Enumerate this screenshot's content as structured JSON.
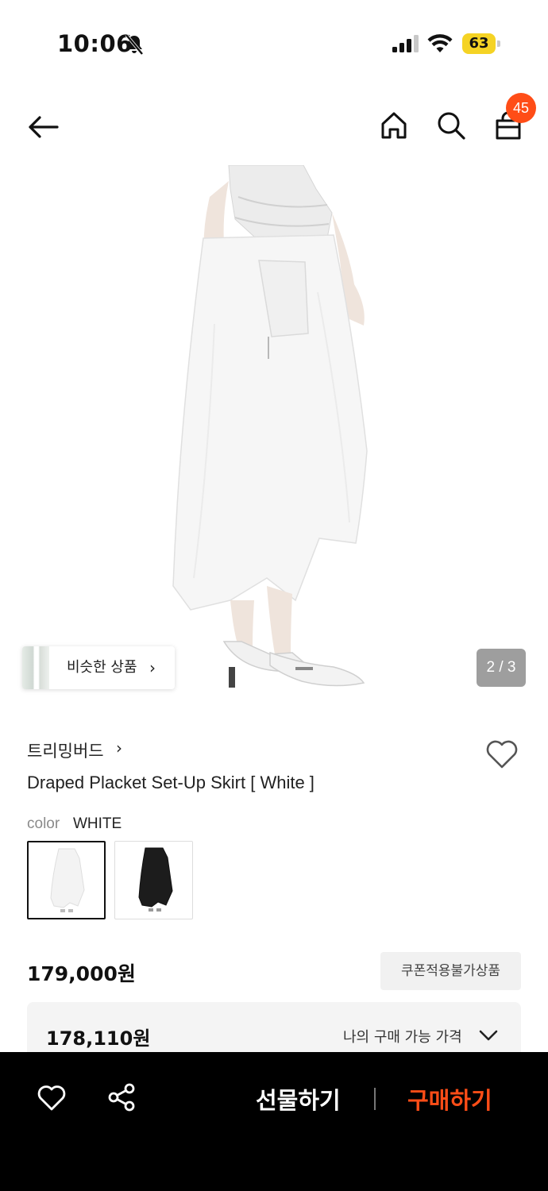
{
  "status_bar": {
    "time": "10:06",
    "battery": "63"
  },
  "nav": {
    "cart_count": "45"
  },
  "image": {
    "similar_label": "비슷한 상품",
    "pager": "2 / 3"
  },
  "product": {
    "brand": "트리밍버드",
    "title": "Draped Placket Set-Up Skirt [ White ]",
    "color_label": "color",
    "color_value": "WHITE",
    "swatches": [
      "white",
      "black"
    ],
    "price": "179,000원",
    "coupon_label": "쿠폰적용불가상품",
    "my_price": "178,110원",
    "my_price_label": "나의 구매 가능 가격"
  },
  "bottom_bar": {
    "gift_label": "선물하기",
    "buy_label": "구매하기"
  },
  "colors": {
    "accent": "#ff4d17",
    "battery": "#f5d324"
  }
}
